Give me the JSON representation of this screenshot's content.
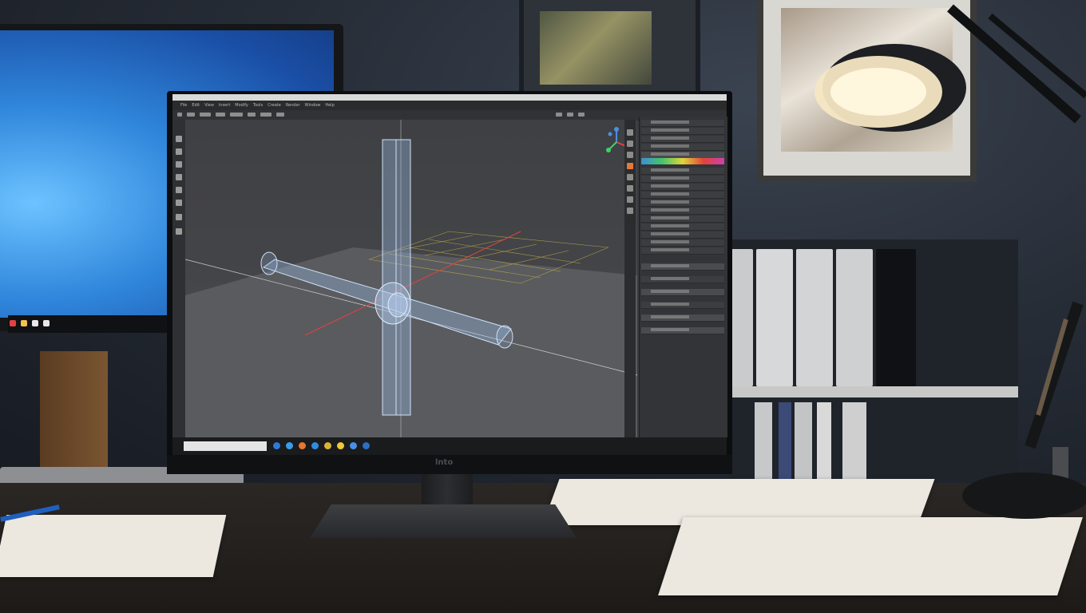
{
  "scene": {
    "description_colors": {
      "wall": "#272d37",
      "desk": "#2b2724",
      "lamp_light": "#f6e7c3",
      "left_screen": "#2f86db"
    }
  },
  "monitor": {
    "brand": "lnto"
  },
  "app": {
    "menu_items": [
      "File",
      "Edit",
      "View",
      "Insert",
      "Modify",
      "Tools",
      "Create",
      "Render",
      "Window",
      "Help"
    ],
    "viewport": {
      "axes_colors": {
        "x": "#e34141",
        "y": "#41d16b",
        "z": "#4a8fe6"
      },
      "wire_color": "#9fc3ee"
    },
    "taskbar": {
      "search_placeholder": ""
    }
  }
}
